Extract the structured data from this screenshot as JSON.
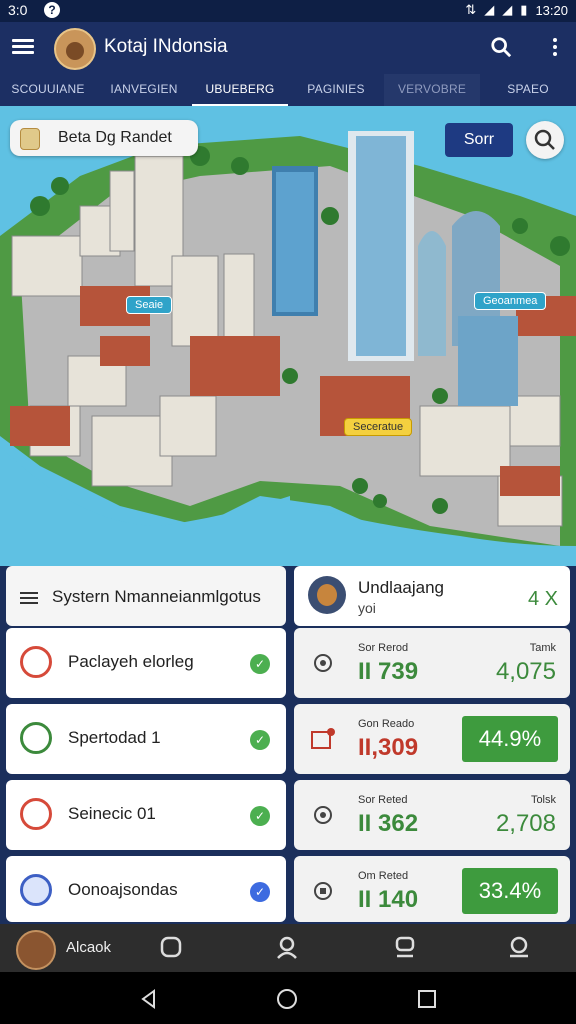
{
  "status": {
    "time": "3:0",
    "clock": "13:20"
  },
  "app": {
    "title": "Kotaj INdonsia"
  },
  "tabs": [
    "SCOUUIANE",
    "IANVEGIEN",
    "UBUEBERG",
    "PAGINIES",
    "VERVOBRE",
    "SPAEO"
  ],
  "map": {
    "search_label": "Beta Dg Randet",
    "start_button": "Sorr",
    "labels": [
      "Seaie",
      "Geoanmea",
      "Seceratue"
    ]
  },
  "system_panel": {
    "title": "Systern Nmanneianmlgotus",
    "items": [
      {
        "label": "Paclayeh elorleg",
        "icon": "tent-icon",
        "color": "#d64a3a",
        "check": "#4caf50"
      },
      {
        "label": "Spertodad 1",
        "icon": "bug-icon",
        "color": "#3c8a3c",
        "check": "#4caf50"
      },
      {
        "label": "Seinecic 01",
        "icon": "document-icon",
        "color": "#d64a3a",
        "check": "#4caf50"
      },
      {
        "label": "Oonoajsondas",
        "icon": "shape-icon",
        "color": "#3d5fc4",
        "check": "#3d6be0"
      }
    ]
  },
  "user_panel": {
    "name": "Undlaajang",
    "sub": "yoi",
    "count": "4 X",
    "stats": [
      {
        "small": "Sor Rerod",
        "big": "II 739",
        "big_color": "#3c8a3c",
        "rsmall": "Tamk",
        "rbig": "4,075",
        "pct": "",
        "icon": "gear-icon"
      },
      {
        "small": "Gon Reado",
        "big": "II,309",
        "big_color": "#c0392b",
        "rsmall": "",
        "rbig": "",
        "pct": "44.9%",
        "icon": "alert-icon"
      },
      {
        "small": "Sor Reted",
        "big": "II 362",
        "big_color": "#3c8a3c",
        "rsmall": "Tolsk",
        "rbig": "2,708",
        "pct": "",
        "icon": "gear-icon"
      },
      {
        "small": "Om Reted",
        "big": "II 140",
        "big_color": "#3c8a3c",
        "rsmall": "",
        "rbig": "",
        "pct": "33.4%",
        "icon": "cog-icon"
      }
    ]
  },
  "bottom_nav": {
    "profile_label": "Alcaok"
  }
}
